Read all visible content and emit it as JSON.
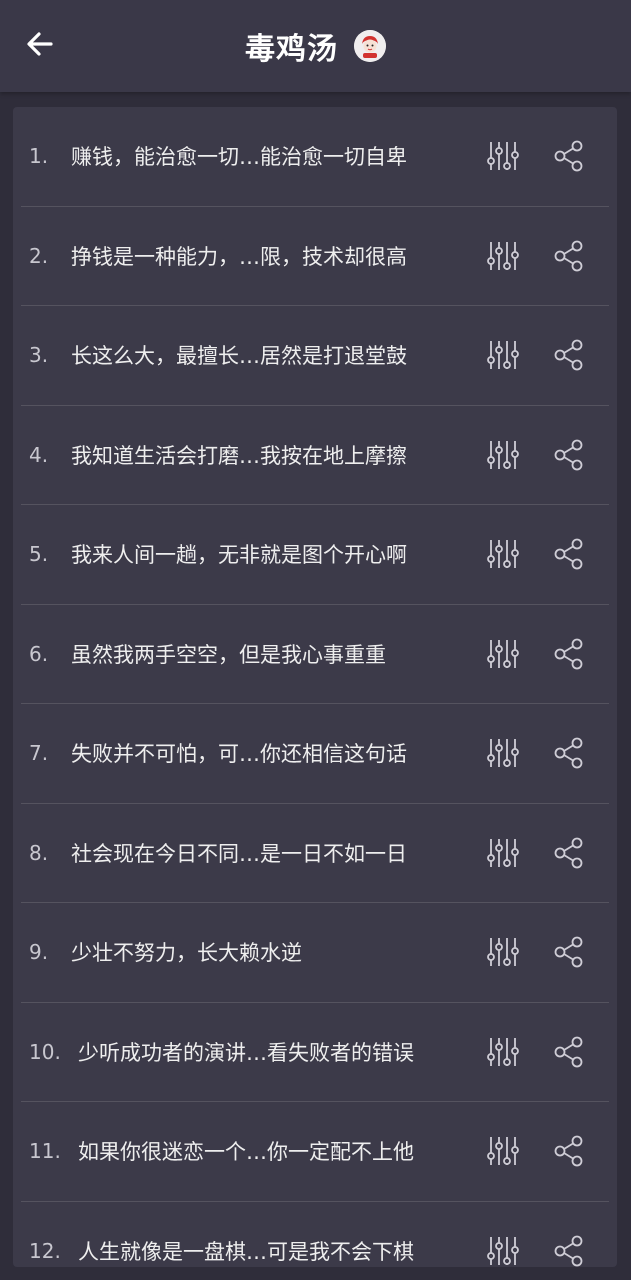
{
  "header": {
    "title": "毒鸡汤",
    "back_icon": "arrow-left-icon",
    "avatar_icon": "avatar"
  },
  "colors": {
    "background": "#2f2d3a",
    "topbar": "#3a3848",
    "panel": "#3c3a49",
    "divider": "#55535f",
    "text": "#eeeeee",
    "icon": "#cfcdd6"
  },
  "list": {
    "items": [
      {
        "num": "1.",
        "text": "赚钱，能治愈一切…能治愈一切自卑"
      },
      {
        "num": "2.",
        "text": "挣钱是一种能力，…限，技术却很高"
      },
      {
        "num": "3.",
        "text": "长这么大，最擅长…居然是打退堂鼓"
      },
      {
        "num": "4.",
        "text": "我知道生活会打磨…我按在地上摩擦"
      },
      {
        "num": "5.",
        "text": "我来人间一趟，无非就是图个开心啊"
      },
      {
        "num": "6.",
        "text": "虽然我两手空空，但是我心事重重"
      },
      {
        "num": "7.",
        "text": "失败并不可怕，可…你还相信这句话"
      },
      {
        "num": "8.",
        "text": "社会现在今日不同…是一日不如一日"
      },
      {
        "num": "9.",
        "text": "少壮不努力，长大赖水逆"
      },
      {
        "num": "10.",
        "text": "少听成功者的演讲…看失败者的错误"
      },
      {
        "num": "11.",
        "text": "如果你很迷恋一个…你一定配不上他"
      },
      {
        "num": "12.",
        "text": "人生就像是一盘棋…可是我不会下棋"
      }
    ],
    "row_icons": [
      "equalizer-icon",
      "share-icon"
    ]
  }
}
